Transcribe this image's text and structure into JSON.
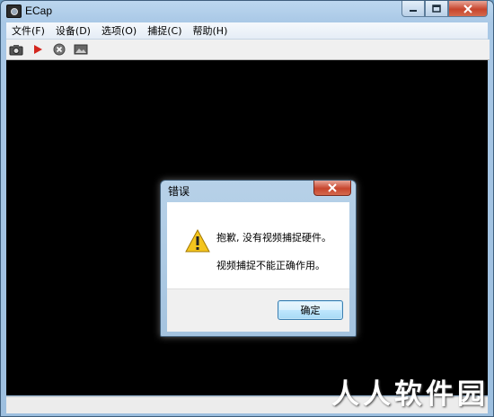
{
  "window": {
    "title": "ECap"
  },
  "menu": [
    "文件(F)",
    "设备(D)",
    "选项(O)",
    "捕捉(C)",
    "帮助(H)"
  ],
  "toolbar": {
    "icons": [
      "camera-icon",
      "play-icon",
      "stop-icon",
      "image-icon"
    ]
  },
  "dialog": {
    "title": "错误",
    "message_line1": "抱歉, 没有视频捕捉硬件。",
    "message_line2": "视频捕捉不能正确作用。",
    "ok_label": "确定"
  },
  "watermark": "人人软件园",
  "colors": {
    "viewport": "#000000",
    "close_button": "#c7452d",
    "window_frame": "#a9c8e6"
  }
}
